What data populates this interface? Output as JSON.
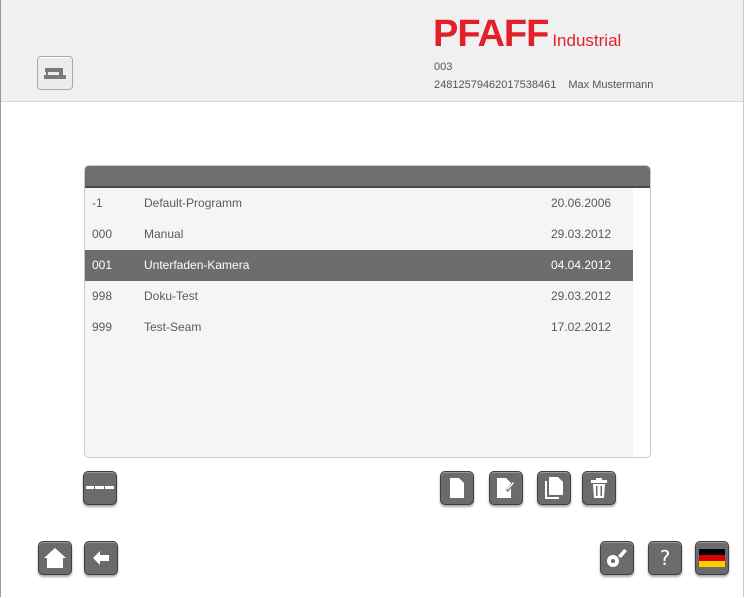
{
  "header": {
    "brand": "PFAFF",
    "brand_sub": "Industrial",
    "program_no": "003",
    "serial": "24812579462017538461",
    "user": "Max Mustermann"
  },
  "programs": [
    {
      "num": "-1",
      "name": "Default-Programm",
      "date": "20.06.2006",
      "selected": false
    },
    {
      "num": "000",
      "name": "Manual",
      "date": "29.03.2012",
      "selected": false
    },
    {
      "num": "001",
      "name": "Unterfaden-Kamera",
      "date": "04.04.2012",
      "selected": true
    },
    {
      "num": "998",
      "name": "Doku-Test",
      "date": "29.03.2012",
      "selected": false
    },
    {
      "num": "999",
      "name": "Test-Seam",
      "date": "17.02.2012",
      "selected": false
    }
  ],
  "help_label": "?",
  "icons": {
    "machine": "sewing-machine-icon",
    "separator": "dash-line-icon",
    "new": "new-document-icon",
    "edit": "edit-document-icon",
    "copy": "copy-document-icon",
    "delete": "trash-icon",
    "home": "home-icon",
    "back": "arrow-left-icon",
    "bobbin": "bobbin-icon",
    "language": "german-flag-icon"
  },
  "colors": {
    "brand": "#e3202a",
    "button": "#6b6b6b",
    "selected_row": "#6d6d6d"
  }
}
